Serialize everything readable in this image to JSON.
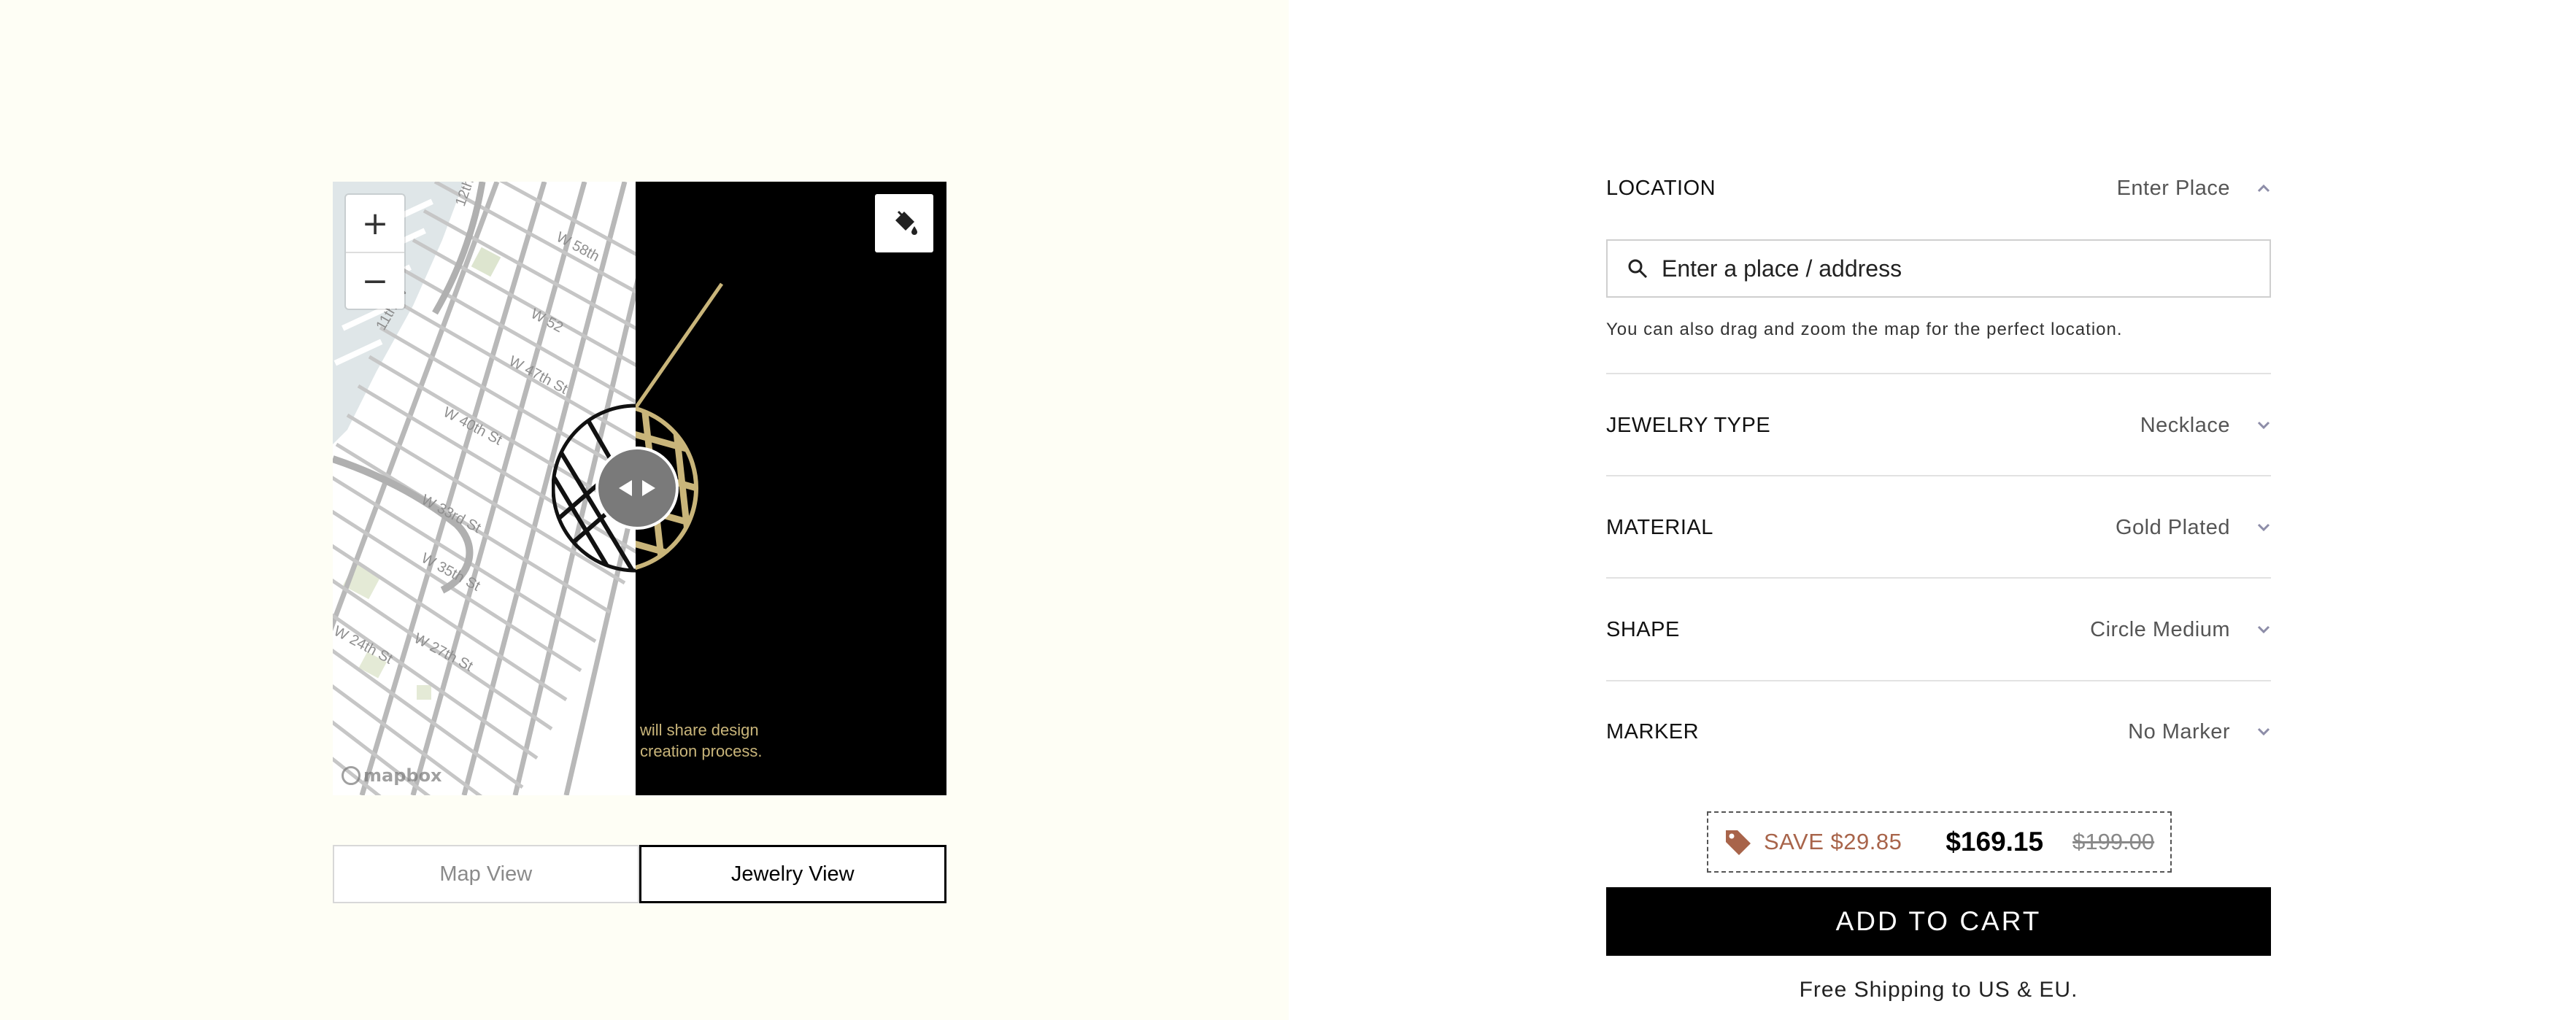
{
  "preview": {
    "zoom_in": "+",
    "zoom_out": "−",
    "mapbox_logo": "mapbox",
    "jewelry_note_line1": "will share design",
    "jewelry_note_line2": "creation process.",
    "street_labels": [
      "W 47th St",
      "W 40th St",
      "W 33rd St",
      "W 35th St",
      "W 24th St",
      "W 27th St",
      "W 52",
      "W 58th",
      "12th Ave",
      "11th Av"
    ]
  },
  "view_toggle": {
    "map_view": "Map View",
    "jewelry_view": "Jewelry View",
    "active": "Jewelry View"
  },
  "config": {
    "location": {
      "label": "LOCATION",
      "value": "Enter Place",
      "expanded": true
    },
    "search": {
      "placeholder": "Enter a place / address",
      "hint": "You can also drag and zoom the map for the perfect location."
    },
    "jewelry_type": {
      "label": "JEWELRY TYPE",
      "value": "Necklace"
    },
    "material": {
      "label": "MATERIAL",
      "value": "Gold Plated"
    },
    "shape": {
      "label": "SHAPE",
      "value": "Circle Medium"
    },
    "marker": {
      "label": "MARKER",
      "value": "No Marker"
    }
  },
  "pricing": {
    "save": "SAVE $29.85",
    "price": "$169.15",
    "original": "$199.00"
  },
  "cart": {
    "button": "ADD TO CART",
    "shipping": "Free Shipping to US & EU."
  },
  "colors": {
    "gold": "#c9b57a",
    "save": "#a8644a",
    "left_bg": "#fefef5"
  }
}
